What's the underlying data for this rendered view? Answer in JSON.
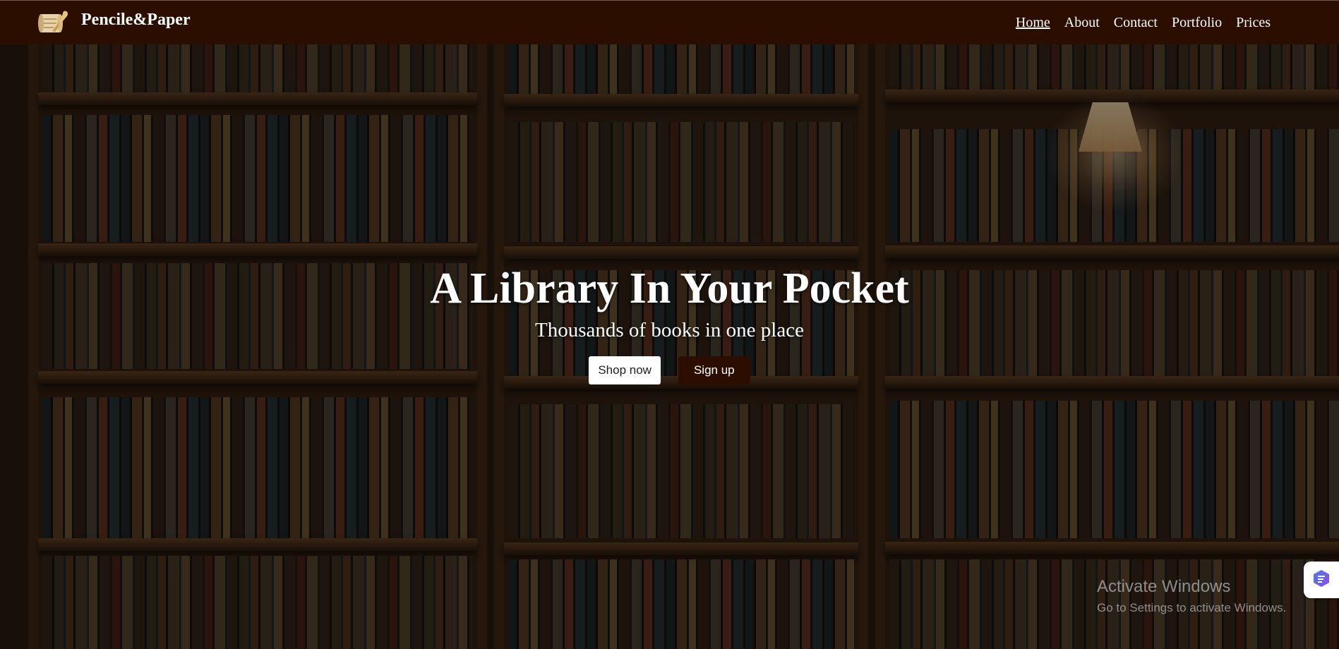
{
  "navbar": {
    "brand": "Pencile&Paper",
    "links": [
      {
        "label": "Home",
        "active": true
      },
      {
        "label": "About",
        "active": false
      },
      {
        "label": "Contact",
        "active": false
      },
      {
        "label": "Portfolio",
        "active": false
      },
      {
        "label": "Prices",
        "active": false
      }
    ],
    "background_color": "#2c0e00",
    "logo_icon": "scroll-quill-icon"
  },
  "hero": {
    "title": "A Library In Your Pocket",
    "subtitle": "Thousands of books in one place",
    "buttons": {
      "primary_label": "Shop now",
      "secondary_label": "Sign up"
    },
    "background": "bookshelf-photo"
  },
  "watermark": {
    "title": "Activate Windows",
    "subtitle": "Go to Settings to activate Windows."
  },
  "side_widget": {
    "icon": "app-widget-icon"
  }
}
